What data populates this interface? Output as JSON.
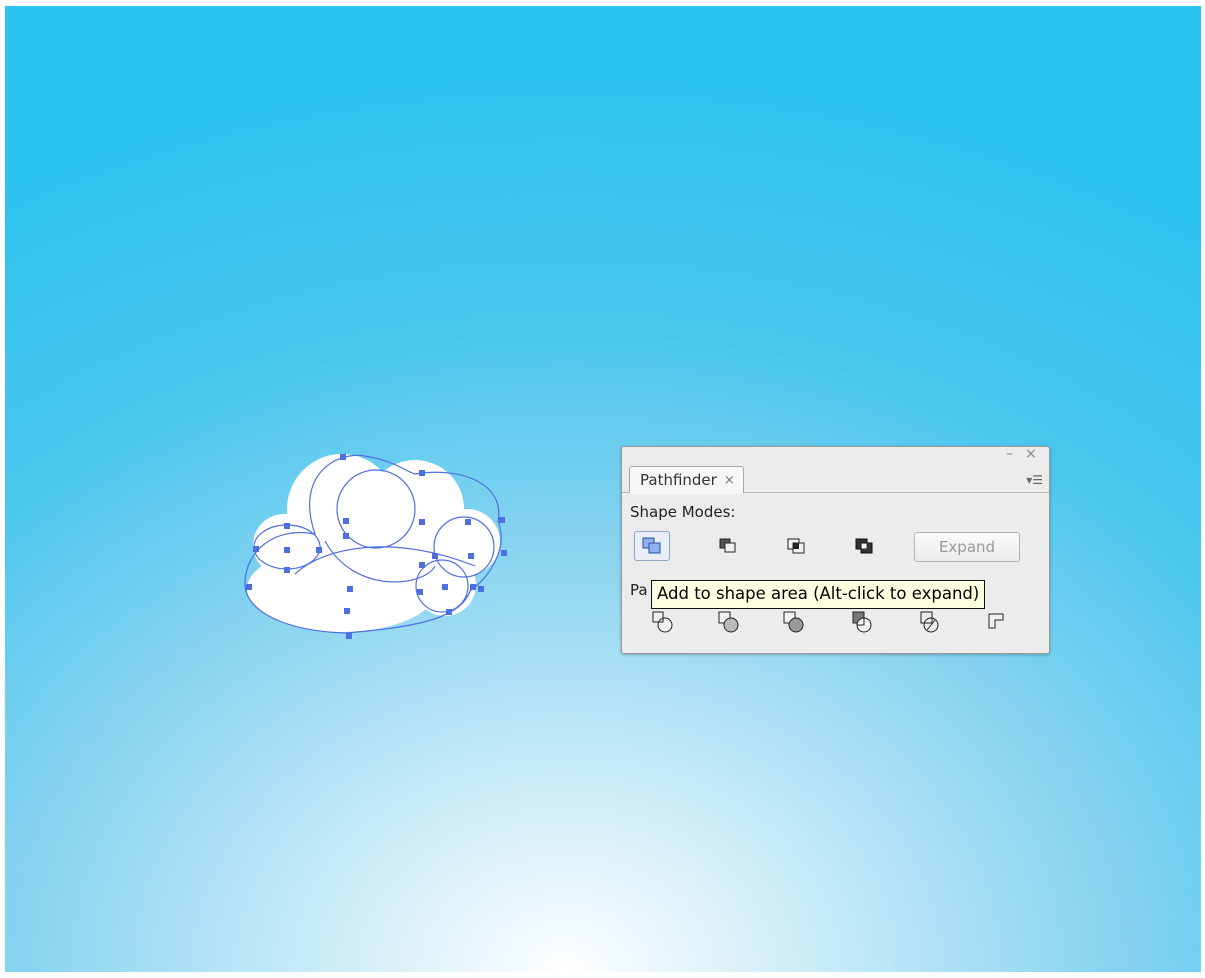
{
  "panel": {
    "minimize_glyph": "–",
    "close_glyph": "×",
    "menu_glyph": "▾☰",
    "tab_label": "Pathfinder",
    "tab_close_glyph": "×",
    "shape_modes_label": "Shape Modes:",
    "shape_mode_buttons": [
      {
        "icon": "unite-icon"
      },
      {
        "icon": "minus-front-icon"
      },
      {
        "icon": "intersect-icon"
      },
      {
        "icon": "exclude-icon"
      }
    ],
    "expand_label": "Expand",
    "pathfinders_label_visible": "Pa",
    "pathfinder_buttons": [
      {
        "icon": "divide-icon"
      },
      {
        "icon": "trim-icon"
      },
      {
        "icon": "merge-icon"
      },
      {
        "icon": "crop-icon"
      },
      {
        "icon": "outline-icon"
      },
      {
        "icon": "minus-back-icon"
      }
    ]
  },
  "tooltip": {
    "text": "Add to shape area (Alt-click to expand)"
  },
  "colors": {
    "selection_blue": "#4f6fe0",
    "cloud_fill": "#ffffff",
    "sky_top": "#2cc3ee",
    "sky_bottom": "#ffffff",
    "tooltip_bg": "#ffffe1"
  }
}
